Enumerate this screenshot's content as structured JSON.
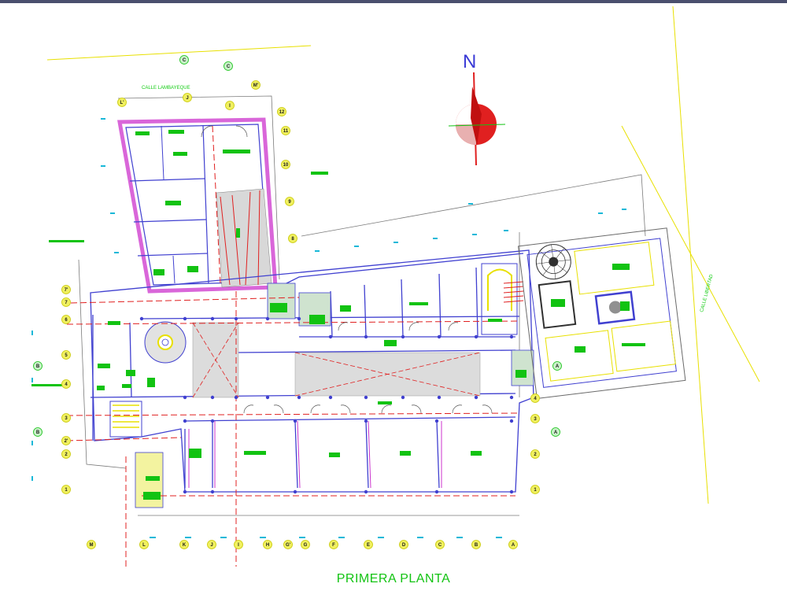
{
  "title": "PRIMERA PLANTA",
  "north_label": "N",
  "streets": {
    "north": "CALLE LAMBAYEQUE",
    "east": "CALLE LIBERTAD"
  },
  "bottom_axis_labels": [
    "M",
    "L",
    "K",
    "J",
    "I",
    "H",
    "G'",
    "G",
    "F",
    "E",
    "D",
    "C",
    "B",
    "A"
  ],
  "top_axis_labels": [
    "L'",
    "J",
    "I",
    "M'"
  ],
  "wing_axis_labels": [
    "12",
    "11",
    "10",
    "9",
    "8"
  ],
  "left_axis_labels": [
    "7'",
    "7",
    "6",
    "5",
    "4",
    "3",
    "2'",
    "2",
    "1"
  ],
  "right_axis_labels": [
    "4",
    "3",
    "2",
    "1"
  ],
  "section_marks": [
    "C",
    "C",
    "B",
    "B",
    "A",
    "A"
  ],
  "colors": {
    "background": "#ffffff",
    "walls": "#4040d0",
    "hidden_lines": "#e02020",
    "text_tags": "#12c312",
    "yellow": "#e8e000",
    "magenta": "#cc33cc",
    "dimension": "#18b8d8"
  }
}
